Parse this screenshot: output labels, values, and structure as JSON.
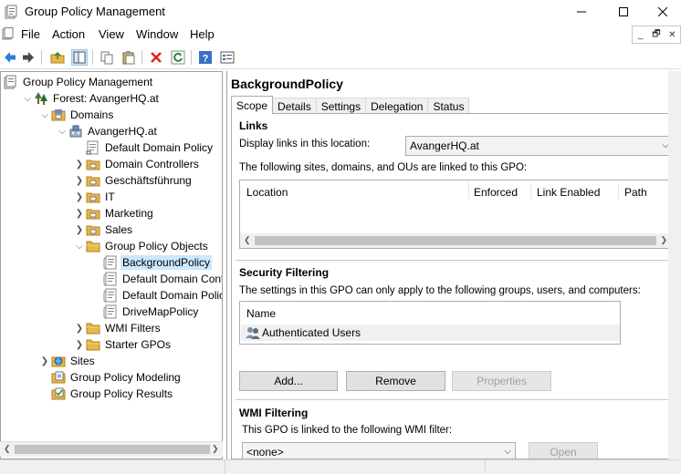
{
  "window": {
    "title": "Group Policy Management"
  },
  "menu": [
    "File",
    "Action",
    "View",
    "Window",
    "Help"
  ],
  "toolbar": [
    "back-icon",
    "forward-icon",
    "up-folder-icon",
    "show-hide-tree-icon",
    "copy-icon",
    "paste-icon",
    "delete-icon",
    "refresh-icon",
    "help-icon",
    "properties-icon"
  ],
  "tree": [
    {
      "label": "Group Policy Management",
      "icon": "gpm-icon",
      "exp": ""
    },
    {
      "label": "Forest: AvangerHQ.at",
      "icon": "forest-icon",
      "exp": "down"
    },
    {
      "label": "Domains",
      "icon": "domains-icon",
      "exp": "down"
    },
    {
      "label": "AvangerHQ.at",
      "icon": "domain-icon",
      "exp": "down"
    },
    {
      "label": "Default Domain Policy",
      "icon": "gpo-link-icon",
      "exp": ""
    },
    {
      "label": "Domain Controllers",
      "icon": "ou-icon",
      "exp": "right"
    },
    {
      "label": "Geschäftsführung",
      "icon": "ou-icon",
      "exp": "right"
    },
    {
      "label": "IT",
      "icon": "ou-icon",
      "exp": "right"
    },
    {
      "label": "Marketing",
      "icon": "ou-icon",
      "exp": "right"
    },
    {
      "label": "Sales",
      "icon": "ou-icon",
      "exp": "right"
    },
    {
      "label": "Group Policy Objects",
      "icon": "folder-icon",
      "exp": "down"
    },
    {
      "label": "BackgroundPolicy",
      "icon": "gpo-icon",
      "exp": "",
      "selected": true
    },
    {
      "label": "Default Domain Contro",
      "icon": "gpo-icon",
      "exp": ""
    },
    {
      "label": "Default Domain Policy",
      "icon": "gpo-icon",
      "exp": ""
    },
    {
      "label": "DriveMapPolicy",
      "icon": "gpo-icon",
      "exp": ""
    },
    {
      "label": "WMI Filters",
      "icon": "folder-icon",
      "exp": "right"
    },
    {
      "label": "Starter GPOs",
      "icon": "folder-icon",
      "exp": "right"
    },
    {
      "label": "Sites",
      "icon": "sites-icon",
      "exp": "right"
    },
    {
      "label": "Group Policy Modeling",
      "icon": "modeling-icon",
      "exp": ""
    },
    {
      "label": "Group Policy Results",
      "icon": "results-icon",
      "exp": ""
    }
  ],
  "details": {
    "title": "BackgroundPolicy",
    "tabs": [
      "Scope",
      "Details",
      "Settings",
      "Delegation",
      "Status"
    ],
    "links": {
      "heading": "Links",
      "display_label": "Display links in this location:",
      "location_value": "AvangerHQ.at",
      "linked_text": "The following sites, domains, and OUs are linked to this GPO:",
      "columns": [
        "Location",
        "Enforced",
        "Link Enabled",
        "Path"
      ]
    },
    "security": {
      "heading": "Security Filtering",
      "desc": "The settings in this GPO can only apply to the following groups, users, and computers:",
      "column": "Name",
      "rows": [
        "Authenticated Users"
      ],
      "buttons": {
        "add": "Add...",
        "remove": "Remove",
        "properties": "Properties"
      }
    },
    "wmi": {
      "heading": "WMI Filtering",
      "desc": "This GPO is linked to the following WMI filter:",
      "value": "<none>",
      "open": "Open"
    }
  },
  "colors": {
    "selection": "#cce8ff",
    "folder": "#e8b84a"
  }
}
